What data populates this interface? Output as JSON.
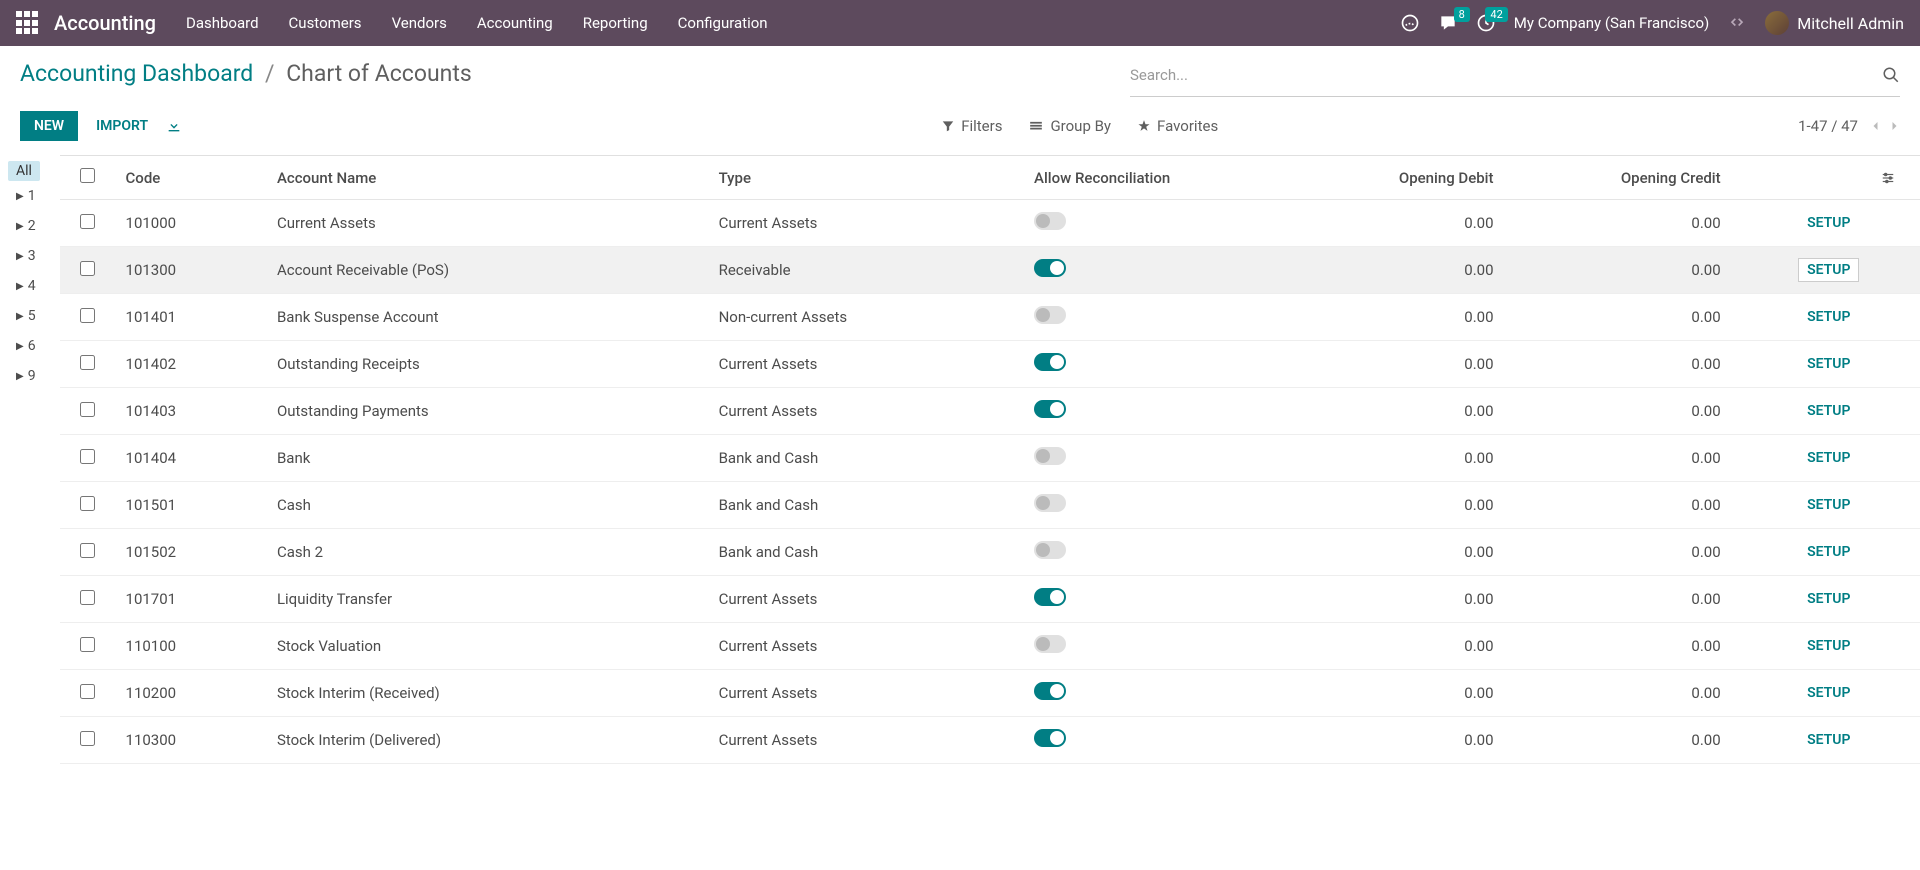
{
  "navbar": {
    "brand": "Accounting",
    "menu": [
      "Dashboard",
      "Customers",
      "Vendors",
      "Accounting",
      "Reporting",
      "Configuration"
    ],
    "messages_badge": "8",
    "activities_badge": "42",
    "company": "My Company (San Francisco)",
    "user": "Mitchell Admin"
  },
  "breadcrumb": {
    "parent": "Accounting Dashboard",
    "current": "Chart of Accounts"
  },
  "search": {
    "placeholder": "Search..."
  },
  "buttons": {
    "new": "NEW",
    "import": "IMPORT"
  },
  "search_options": {
    "filters": "Filters",
    "group_by": "Group By",
    "favorites": "Favorites"
  },
  "pager": {
    "range": "1-47 / 47"
  },
  "sidebar": {
    "all": "All",
    "items": [
      "1",
      "2",
      "3",
      "4",
      "5",
      "6",
      "9"
    ]
  },
  "columns": {
    "code": "Code",
    "name": "Account Name",
    "type": "Type",
    "rec": "Allow Reconciliation",
    "debit": "Opening Debit",
    "credit": "Opening Credit"
  },
  "setup_label": "SETUP",
  "rows": [
    {
      "code": "101000",
      "name": "Current Assets",
      "type": "Current Assets",
      "rec": false,
      "debit": "0.00",
      "credit": "0.00",
      "hover": false
    },
    {
      "code": "101300",
      "name": "Account Receivable (PoS)",
      "type": "Receivable",
      "rec": true,
      "debit": "0.00",
      "credit": "0.00",
      "hover": true
    },
    {
      "code": "101401",
      "name": "Bank Suspense Account",
      "type": "Non-current Assets",
      "rec": false,
      "debit": "0.00",
      "credit": "0.00",
      "hover": false
    },
    {
      "code": "101402",
      "name": "Outstanding Receipts",
      "type": "Current Assets",
      "rec": true,
      "debit": "0.00",
      "credit": "0.00",
      "hover": false
    },
    {
      "code": "101403",
      "name": "Outstanding Payments",
      "type": "Current Assets",
      "rec": true,
      "debit": "0.00",
      "credit": "0.00",
      "hover": false
    },
    {
      "code": "101404",
      "name": "Bank",
      "type": "Bank and Cash",
      "rec": false,
      "debit": "0.00",
      "credit": "0.00",
      "hover": false
    },
    {
      "code": "101501",
      "name": "Cash",
      "type": "Bank and Cash",
      "rec": false,
      "debit": "0.00",
      "credit": "0.00",
      "hover": false
    },
    {
      "code": "101502",
      "name": "Cash 2",
      "type": "Bank and Cash",
      "rec": false,
      "debit": "0.00",
      "credit": "0.00",
      "hover": false
    },
    {
      "code": "101701",
      "name": "Liquidity Transfer",
      "type": "Current Assets",
      "rec": true,
      "debit": "0.00",
      "credit": "0.00",
      "hover": false
    },
    {
      "code": "110100",
      "name": "Stock Valuation",
      "type": "Current Assets",
      "rec": false,
      "debit": "0.00",
      "credit": "0.00",
      "hover": false
    },
    {
      "code": "110200",
      "name": "Stock Interim (Received)",
      "type": "Current Assets",
      "rec": true,
      "debit": "0.00",
      "credit": "0.00",
      "hover": false
    },
    {
      "code": "110300",
      "name": "Stock Interim (Delivered)",
      "type": "Current Assets",
      "rec": true,
      "debit": "0.00",
      "credit": "0.00",
      "hover": false
    }
  ]
}
